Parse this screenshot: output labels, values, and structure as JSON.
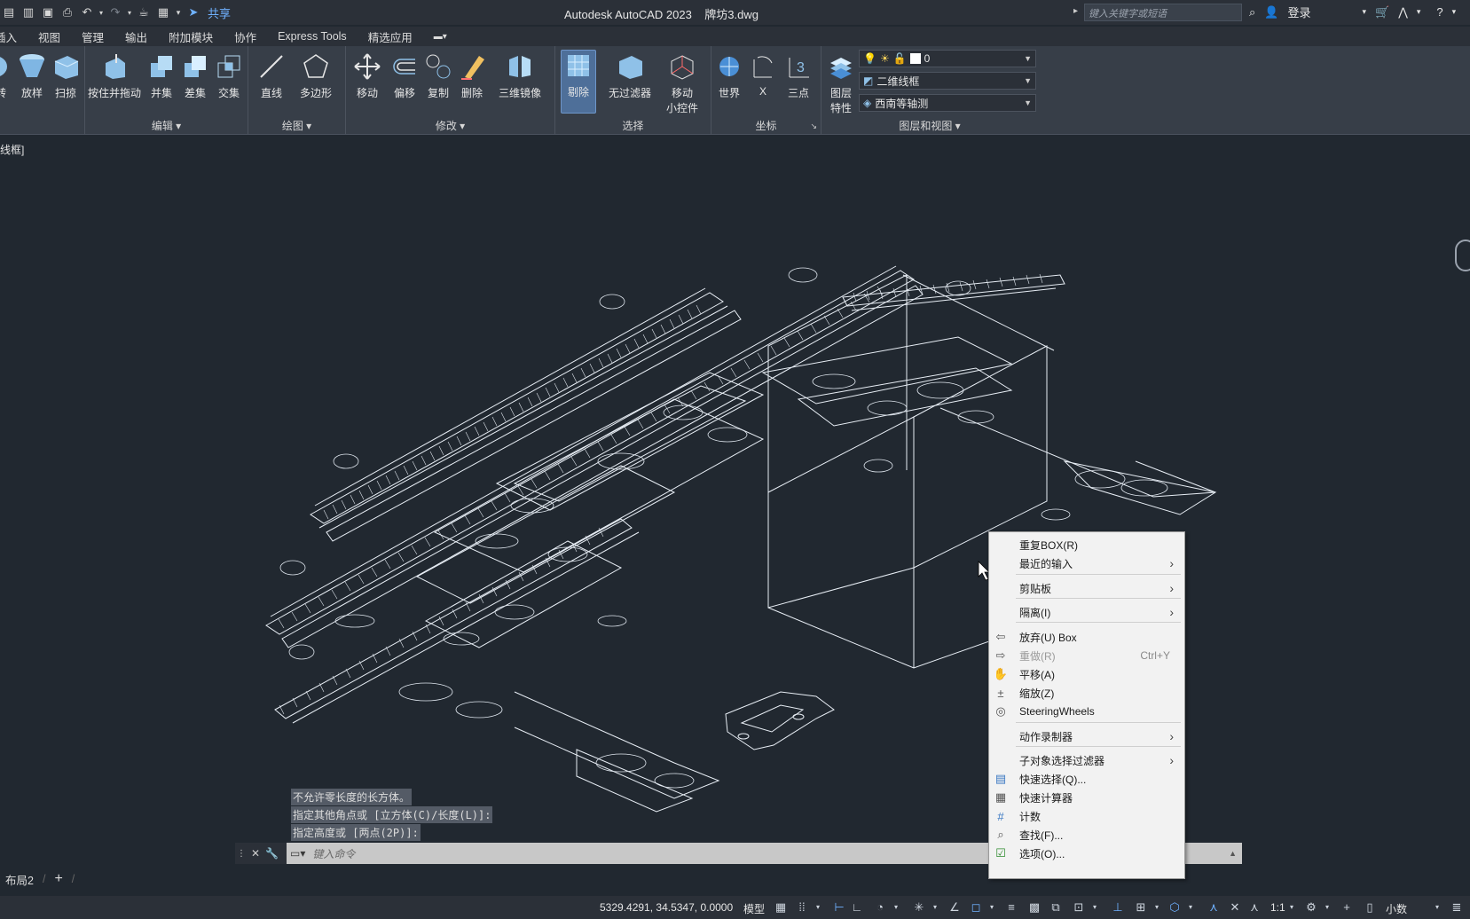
{
  "titlebar": {
    "app_title": "Autodesk AutoCAD 2023",
    "file_name": "牌坊3.dwg",
    "share_label": "共享",
    "search_placeholder": "键入关键字或短语",
    "login_label": "登录"
  },
  "tabs": [
    "插入",
    "视图",
    "管理",
    "输出",
    "附加模块",
    "协作",
    "Express Tools",
    "精选应用"
  ],
  "ribbon": {
    "panels": {
      "edit_title": "编辑",
      "draw_title": "绘图",
      "modify_title": "修改",
      "select_title": "选择",
      "coord_title": "坐标",
      "layer_title": "图层和视图"
    },
    "buttons": {
      "revolve": "转",
      "loft": "放样",
      "sweep": "扫掠",
      "presspull": "按住并拖动",
      "union": "并集",
      "subtract": "差集",
      "intersect": "交集",
      "line": "直线",
      "polygon": "多边形",
      "move": "移动",
      "offset": "偏移",
      "copy": "复制",
      "erase": "删除",
      "mirror3d": "三维镜像",
      "cull": "剔除",
      "nofilter": "无过滤器",
      "gizmo_line1": "移动",
      "gizmo_line2": "小控件",
      "world": "世界",
      "x": "X",
      "threepoint": "三点",
      "layerprops_line1": "图层",
      "layerprops_line2": "特性"
    },
    "layer_current": "0",
    "visual_style": "二维线框",
    "view_preset": "西南等轴测"
  },
  "viewport_label": "线框]",
  "command_history": [
    "不允许零长度的长方体。",
    "指定其他角点或 [立方体(C)/长度(L)]:",
    "指定高度或 [两点(2P)]:"
  ],
  "command_placeholder": "键入命令",
  "layout_tabs": [
    "布局2"
  ],
  "statusbar": {
    "coords": "5329.4291, 34.5347, 0.0000",
    "model": "模型",
    "scale": "1:1",
    "units": "小数"
  },
  "context_menu": {
    "items": [
      {
        "label": "重复BOX(R)",
        "icon": "",
        "submenu": false,
        "shortcut": "",
        "disabled": false
      },
      {
        "label": "最近的输入",
        "icon": "",
        "submenu": true,
        "shortcut": "",
        "disabled": false
      },
      {
        "label": "剪贴板",
        "icon": "",
        "submenu": true,
        "shortcut": "",
        "disabled": false
      },
      {
        "label": "隔离(I)",
        "icon": "",
        "submenu": true,
        "shortcut": "",
        "disabled": false
      },
      {
        "label": "放弃(U) Box",
        "icon": "undo-icon",
        "submenu": false,
        "shortcut": "",
        "disabled": false
      },
      {
        "label": "重做(R)",
        "icon": "redo-icon",
        "submenu": false,
        "shortcut": "Ctrl+Y",
        "disabled": true
      },
      {
        "label": "平移(A)",
        "icon": "pan-hand-icon",
        "submenu": false,
        "shortcut": "",
        "disabled": false
      },
      {
        "label": "缩放(Z)",
        "icon": "zoom-icon",
        "submenu": false,
        "shortcut": "",
        "disabled": false
      },
      {
        "label": "SteeringWheels",
        "icon": "steeringwheel-icon",
        "submenu": false,
        "shortcut": "",
        "disabled": false
      },
      {
        "label": "动作录制器",
        "icon": "",
        "submenu": true,
        "shortcut": "",
        "disabled": false
      },
      {
        "label": "子对象选择过滤器",
        "icon": "",
        "submenu": true,
        "shortcut": "",
        "disabled": false
      },
      {
        "label": "快速选择(Q)...",
        "icon": "quickselect-icon",
        "submenu": false,
        "shortcut": "",
        "disabled": false
      },
      {
        "label": "快速计算器",
        "icon": "calculator-icon",
        "submenu": false,
        "shortcut": "",
        "disabled": false
      },
      {
        "label": "计数",
        "icon": "count-icon",
        "submenu": false,
        "shortcut": "",
        "disabled": false
      },
      {
        "label": "查找(F)...",
        "icon": "find-icon",
        "submenu": false,
        "shortcut": "",
        "disabled": false
      },
      {
        "label": "选项(O)...",
        "icon": "options-check-icon",
        "submenu": false,
        "shortcut": "",
        "disabled": false
      }
    ]
  }
}
